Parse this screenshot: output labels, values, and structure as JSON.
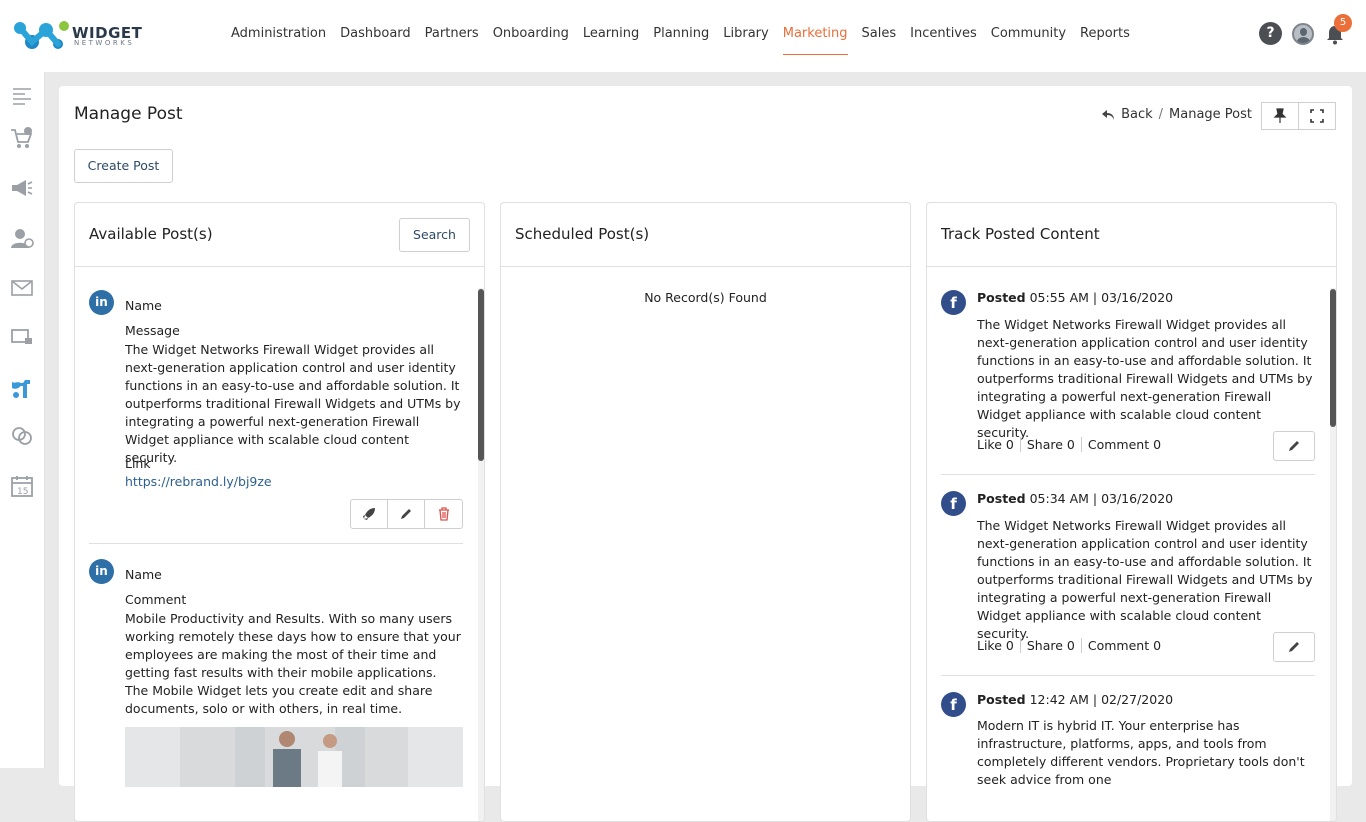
{
  "brand": {
    "name": "WIDGET",
    "sub": "NETWORKS"
  },
  "nav": {
    "items": [
      "Administration",
      "Dashboard",
      "Partners",
      "Onboarding",
      "Learning",
      "Planning",
      "Library",
      "Marketing",
      "Sales",
      "Incentives",
      "Community",
      "Reports"
    ],
    "active": "Marketing"
  },
  "top": {
    "help": "?",
    "notif_count": "5"
  },
  "sidebar_icons": [
    "menu-icon",
    "cart-add-icon",
    "megaphone-icon",
    "user-settings-icon",
    "mail-icon",
    "screen-icon",
    "social-post-icon",
    "links-icon",
    "calendar-icon"
  ],
  "page": {
    "title": "Manage Post",
    "back": "Back",
    "crumb_sep": "/",
    "crumb_current": "Manage Post",
    "create_label": "Create Post"
  },
  "available": {
    "title": "Available Post(s)",
    "search_label": "Search",
    "posts": [
      {
        "network": "in",
        "name_label": "Name",
        "field_label": "Message",
        "text": "The Widget Networks Firewall Widget provides all next-generation application control and user identity functions in an easy-to-use and affordable solution. It outperforms traditional Firewall Widgets and UTMs by integrating a powerful next-generation Firewall Widget appliance with scalable cloud content security.",
        "link_label": "Link",
        "link": "https://rebrand.ly/bj9ze"
      },
      {
        "network": "in",
        "name_label": "Name",
        "field_label": "Comment",
        "text": "Mobile Productivity and Results. With so many users working remotely these days how to ensure that your employees are making the most of their time and getting fast results with their mobile applications. The Mobile Widget lets you create edit and share documents, solo or with others, in real time."
      }
    ]
  },
  "scheduled": {
    "title": "Scheduled Post(s)",
    "empty": "No Record(s) Found"
  },
  "track": {
    "title": "Track Posted Content",
    "posted_label": "Posted",
    "items": [
      {
        "time": "05:55 AM | 03/16/2020",
        "text": "The Widget Networks Firewall Widget provides all next-generation application control and user identity functions in an easy-to-use and affordable solution. It outperforms traditional Firewall Widgets and UTMs by integrating a powerful next-generation Firewall Widget appliance with scalable cloud content security.",
        "likes": "Like 0",
        "shares": "Share 0",
        "comments": "Comment 0"
      },
      {
        "time": "05:34 AM | 03/16/2020",
        "text": "The Widget Networks Firewall Widget provides all next-generation application control and user identity functions in an easy-to-use and affordable solution. It outperforms traditional Firewall Widgets and UTMs by integrating a powerful next-generation Firewall Widget appliance with scalable cloud content security.",
        "likes": "Like 0",
        "shares": "Share 0",
        "comments": "Comment 0"
      },
      {
        "time": "12:42 AM | 02/27/2020",
        "text": "Modern IT is hybrid IT. Your enterprise has infrastructure, platforms, apps, and tools from completely different vendors. Proprietary tools don't seek advice from one"
      }
    ]
  },
  "colors": {
    "accent": "#e86f3a",
    "linkedin": "#2d6fa6",
    "facebook": "#314d8a",
    "delete": "#d9534f"
  }
}
